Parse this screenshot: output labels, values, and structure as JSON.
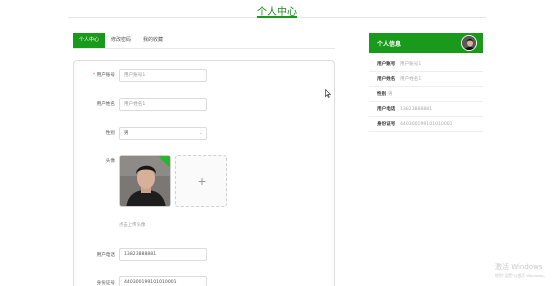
{
  "header": {
    "title": "个人中心"
  },
  "tabs": [
    {
      "label": "个人中心",
      "active": true
    },
    {
      "label": "修改密码",
      "active": false
    },
    {
      "label": "我的收藏",
      "active": false
    }
  ],
  "form": {
    "account": {
      "label": "用户账号",
      "required": "*",
      "placeholder": "用户账号1"
    },
    "name": {
      "label": "用户姓名",
      "placeholder": "用户姓名1"
    },
    "gender": {
      "label": "性别",
      "value": "男"
    },
    "avatar": {
      "label": "头像",
      "hint": "点击上传头像"
    },
    "phone": {
      "label": "用户电话",
      "value": "13823888881"
    },
    "id_card": {
      "label": "身份证号",
      "value": "440300199101010001"
    }
  },
  "info_panel": {
    "title": "个人信息",
    "rows": [
      {
        "key": "用户账号",
        "value": "用户账号1"
      },
      {
        "key": "用户姓名",
        "value": "用户姓名1"
      },
      {
        "key": "性别",
        "value": "男"
      },
      {
        "key": "用户电话",
        "value": "13823888881"
      },
      {
        "key": "身份证号",
        "value": "440300199101010001"
      }
    ]
  },
  "watermark": {
    "title": "激活 Windows",
    "subtitle": "转到\"设置\"以激活 Windows。"
  },
  "colors": {
    "accent": "#1a9a1a"
  },
  "icons": [
    "cursor-icon",
    "plus-icon",
    "chevron-down-icon"
  ]
}
